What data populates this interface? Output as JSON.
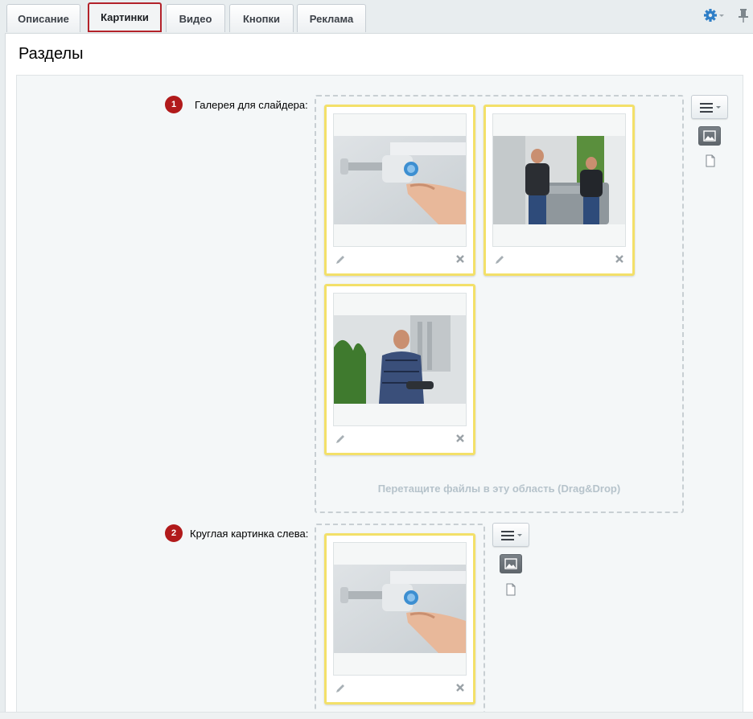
{
  "tabs": [
    {
      "label": "Описание",
      "active": false
    },
    {
      "label": "Картинки",
      "active": true
    },
    {
      "label": "Видео",
      "active": false
    },
    {
      "label": "Кнопки",
      "active": false
    },
    {
      "label": "Реклама",
      "active": false
    }
  ],
  "toolbar": {
    "gear_icon": "gear-icon",
    "pin_icon": "pin-icon"
  },
  "panel": {
    "title": "Разделы"
  },
  "fields": [
    {
      "number": "1",
      "label": "Галерея для слайдера:",
      "images": [
        "thermostat-valve-photo",
        "workers-moving-boiler-photo",
        "technician-with-tools-photo"
      ],
      "dropzone_hint": "Перетащите файлы в эту область (Drag&Drop)"
    },
    {
      "number": "2",
      "label": "Круглая картинка слева:",
      "images": [
        "thermostat-valve-photo"
      ]
    }
  ],
  "colors": {
    "accent_red": "#b11a1b",
    "card_border": "#f3e069",
    "active_tab_border": "#b3222a"
  }
}
